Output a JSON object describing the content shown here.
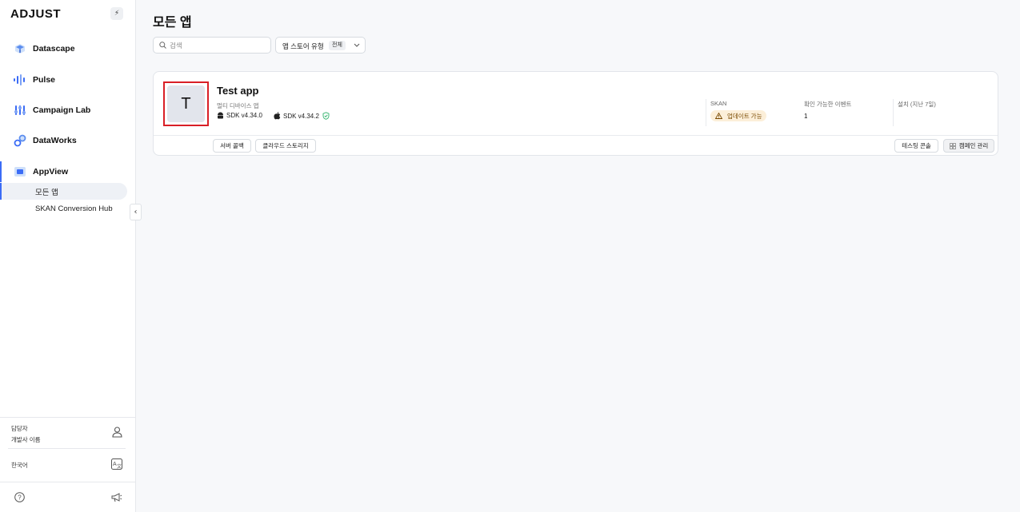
{
  "brand": {
    "logo": "ADJUST",
    "bolt_icon": "bolt-icon"
  },
  "sidebar": {
    "items": [
      {
        "label": "Datascape",
        "icon": "datascape-icon"
      },
      {
        "label": "Pulse",
        "icon": "pulse-icon"
      },
      {
        "label": "Campaign Lab",
        "icon": "campaign-lab-icon"
      },
      {
        "label": "DataWorks",
        "icon": "dataworks-icon"
      },
      {
        "label": "AppView",
        "icon": "appview-icon",
        "active": true
      }
    ],
    "subitems": [
      {
        "label": "모든 앱",
        "active": true
      },
      {
        "label": "SKAN Conversion Hub"
      }
    ],
    "footer": {
      "role": "담당자",
      "developer": "개발사 이름",
      "language": "한국어"
    },
    "accent": "#3b6cf6"
  },
  "main": {
    "title": "모든 앱",
    "search": {
      "placeholder": "검색"
    },
    "filter": {
      "label": "앱 스토어 유형",
      "value": "전체"
    }
  },
  "app_card": {
    "avatar_letter": "T",
    "name": "Test app",
    "type": "멀티 디바이스 앱",
    "sdk_android": "SDK v4.34.0",
    "sdk_ios": "SDK v4.34.2",
    "columns": {
      "skan_head": "SKAN",
      "skan_badge": "업데이트 가능",
      "events_head": "확인 가능한 이벤트",
      "events_value": "1",
      "installs_head": "설치 (지난 7일)"
    },
    "buttons": {
      "server_callback": "서버 콜백",
      "cloud_storage": "클라우드 스토리지",
      "testing_console": "테스팅 콘솔",
      "campaign_manage": "캠페인 관리"
    },
    "highlight_color": "#d91f26",
    "badge_color": "#fcefd9"
  }
}
